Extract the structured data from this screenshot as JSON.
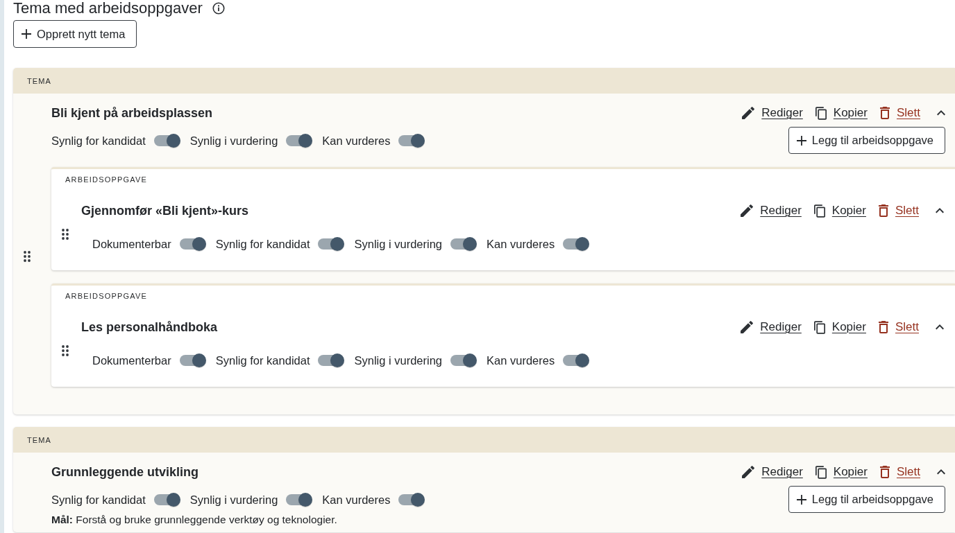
{
  "page": {
    "title": "Tema med arbeidsoppgaver",
    "create_button": "Opprett nytt tema"
  },
  "themes": [
    {
      "section_label": "TEMA",
      "title": "Bli kjent på arbeidsplassen",
      "expanded": true,
      "actions": [
        {
          "kind": "edit",
          "label": "Rediger"
        },
        {
          "kind": "copy",
          "label": "Kopier"
        },
        {
          "kind": "delete",
          "label": "Slett"
        }
      ],
      "toggles": [
        {
          "label": "Synlig for kandidat",
          "on": true
        },
        {
          "label": "Synlig i vurdering",
          "on": true
        },
        {
          "label": "Kan vurderes",
          "on": true
        }
      ],
      "add_task_button": "Legg til arbeidsoppgave",
      "tasks": [
        {
          "section_label": "ARBEIDSOPPGAVE",
          "title": "Gjennomfør «Bli kjent»-kurs",
          "expanded": true,
          "actions": [
            {
              "kind": "edit",
              "label": "Rediger"
            },
            {
              "kind": "copy",
              "label": "Kopier"
            },
            {
              "kind": "delete",
              "label": "Slett"
            }
          ],
          "toggles": [
            {
              "label": "Dokumenterbar",
              "on": true
            },
            {
              "label": "Synlig for kandidat",
              "on": true
            },
            {
              "label": "Synlig i vurdering",
              "on": true
            },
            {
              "label": "Kan vurderes",
              "on": true
            }
          ]
        },
        {
          "section_label": "ARBEIDSOPPGAVE",
          "title": "Les personalhåndboka",
          "expanded": true,
          "actions": [
            {
              "kind": "edit",
              "label": "Rediger"
            },
            {
              "kind": "copy",
              "label": "Kopier"
            },
            {
              "kind": "delete",
              "label": "Slett"
            }
          ],
          "toggles": [
            {
              "label": "Dokumenterbar",
              "on": true
            },
            {
              "label": "Synlig for kandidat",
              "on": true
            },
            {
              "label": "Synlig i vurdering",
              "on": true
            },
            {
              "label": "Kan vurderes",
              "on": true
            }
          ]
        }
      ]
    },
    {
      "section_label": "TEMA",
      "title": "Grunnleggende utvikling",
      "expanded": true,
      "actions": [
        {
          "kind": "edit",
          "label": "Rediger"
        },
        {
          "kind": "copy",
          "label": "Kopier"
        },
        {
          "kind": "delete",
          "label": "Slett"
        }
      ],
      "toggles": [
        {
          "label": "Synlig for kandidat",
          "on": true
        },
        {
          "label": "Synlig i vurdering",
          "on": true
        },
        {
          "label": "Kan vurderes",
          "on": true
        }
      ],
      "add_task_button": "Legg til arbeidsoppgave",
      "goal": "**Mål:** Forstå og bruke grunnleggende verktøy og teknologier."
    }
  ]
}
